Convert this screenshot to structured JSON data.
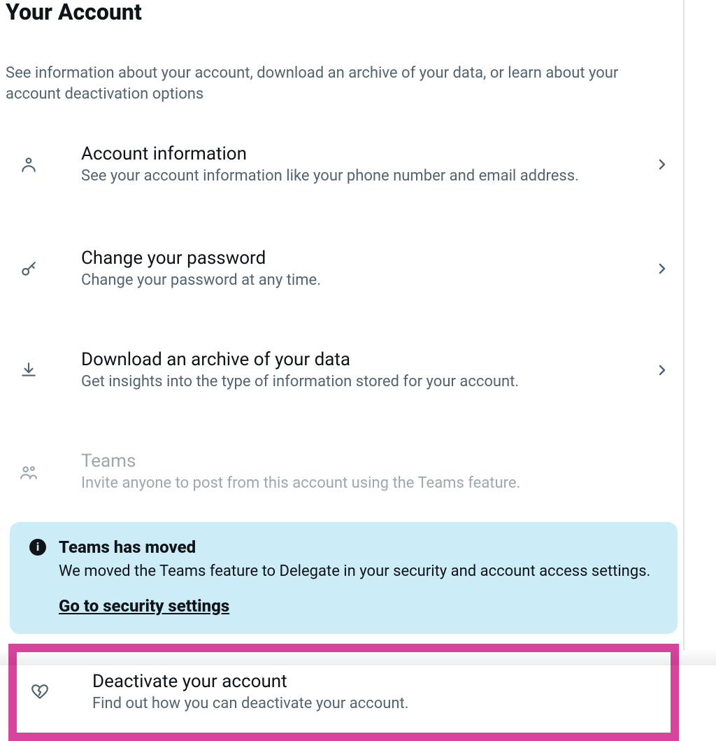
{
  "page": {
    "title": "Your Account",
    "description": "See information about your account, download an archive of your data, or learn about your account deactivation options"
  },
  "items": [
    {
      "title": "Account information",
      "subtitle": "See your account information like your phone number and email address."
    },
    {
      "title": "Change your password",
      "subtitle": "Change your password at any time."
    },
    {
      "title": "Download an archive of your data",
      "subtitle": "Get insights into the type of information stored for your account."
    },
    {
      "title": "Teams",
      "subtitle": "Invite anyone to post from this account using the Teams feature."
    },
    {
      "title": "Deactivate your account",
      "subtitle": "Find out how you can deactivate your account."
    }
  ],
  "notice": {
    "title": "Teams has moved",
    "text": "We moved the Teams feature to Delegate in your security and account access settings.",
    "link": "Go to security settings"
  }
}
